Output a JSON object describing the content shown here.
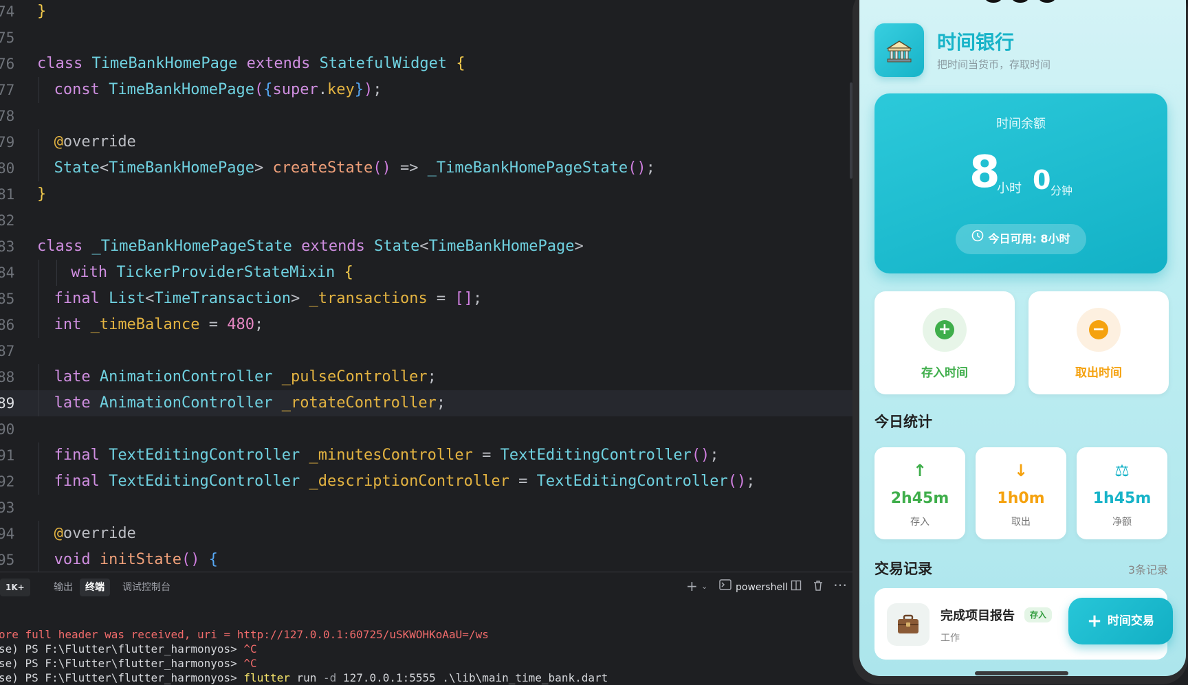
{
  "editor": {
    "lines": [
      {
        "n": "74",
        "tokens": [
          [
            "br1",
            "}"
          ]
        ]
      },
      {
        "n": "75",
        "tokens": []
      },
      {
        "n": "76",
        "tokens": [
          [
            "kw",
            "class "
          ],
          [
            "cls",
            "TimeBankHomePage "
          ],
          [
            "kw",
            "extends "
          ],
          [
            "cls",
            "StatefulWidget "
          ],
          [
            "br1",
            "{"
          ]
        ]
      },
      {
        "n": "77",
        "indent": 1,
        "tokens": [
          [
            "kw",
            "const "
          ],
          [
            "cls",
            "TimeBankHomePage"
          ],
          [
            "br2",
            "("
          ],
          [
            "br3",
            "{"
          ],
          [
            "kw",
            "super"
          ],
          [
            "punc",
            "."
          ],
          [
            "ann",
            "key"
          ],
          [
            "br3",
            "}"
          ],
          [
            "br2",
            ")"
          ],
          [
            "punc",
            ";"
          ]
        ]
      },
      {
        "n": "78",
        "tokens": []
      },
      {
        "n": "79",
        "indent": 1,
        "tokens": [
          [
            "ann",
            "@"
          ],
          [
            "punc",
            "override"
          ]
        ]
      },
      {
        "n": "80",
        "indent": 1,
        "tokens": [
          [
            "cls",
            "State"
          ],
          [
            "punc",
            "<"
          ],
          [
            "cls",
            "TimeBankHomePage"
          ],
          [
            "punc",
            "> "
          ],
          [
            "fn",
            "createState"
          ],
          [
            "br2",
            "()"
          ],
          [
            "punc",
            " => "
          ],
          [
            "cls",
            "_TimeBankHomePageState"
          ],
          [
            "br2",
            "()"
          ],
          [
            "punc",
            ";"
          ]
        ]
      },
      {
        "n": "81",
        "tokens": [
          [
            "br1",
            "}"
          ]
        ]
      },
      {
        "n": "82",
        "tokens": []
      },
      {
        "n": "83",
        "tokens": [
          [
            "kw",
            "class "
          ],
          [
            "cls",
            "_TimeBankHomePageState "
          ],
          [
            "kw",
            "extends "
          ],
          [
            "cls",
            "State"
          ],
          [
            "punc",
            "<"
          ],
          [
            "cls",
            "TimeBankHomePage"
          ],
          [
            "punc",
            ">"
          ]
        ]
      },
      {
        "n": "84",
        "indent": 2,
        "tokens": [
          [
            "kw",
            "with "
          ],
          [
            "cls",
            "TickerProviderStateMixin "
          ],
          [
            "br1",
            "{"
          ]
        ]
      },
      {
        "n": "85",
        "indent": 1,
        "tokens": [
          [
            "kw",
            "final "
          ],
          [
            "cls",
            "List"
          ],
          [
            "punc",
            "<"
          ],
          [
            "cls",
            "TimeTransaction"
          ],
          [
            "punc",
            "> "
          ],
          [
            "ann",
            "_transactions"
          ],
          [
            "punc",
            " = "
          ],
          [
            "br2",
            "[]"
          ],
          [
            "punc",
            ";"
          ]
        ]
      },
      {
        "n": "86",
        "indent": 1,
        "tokens": [
          [
            "kw",
            "int "
          ],
          [
            "ann",
            "_timeBalance"
          ],
          [
            "punc",
            " = "
          ],
          [
            "num",
            "480"
          ],
          [
            "punc",
            ";"
          ]
        ]
      },
      {
        "n": "87",
        "tokens": []
      },
      {
        "n": "88",
        "indent": 1,
        "tokens": [
          [
            "kw",
            "late "
          ],
          [
            "cls",
            "AnimationController "
          ],
          [
            "ann",
            "_pulseController"
          ],
          [
            "punc",
            ";"
          ]
        ]
      },
      {
        "n": "89",
        "indent": 1,
        "current": true,
        "tokens": [
          [
            "kw",
            "late "
          ],
          [
            "cls",
            "AnimationController "
          ],
          [
            "ann",
            "_rotateController"
          ],
          [
            "punc",
            ";"
          ]
        ]
      },
      {
        "n": "90",
        "tokens": []
      },
      {
        "n": "91",
        "indent": 1,
        "tokens": [
          [
            "kw",
            "final "
          ],
          [
            "cls",
            "TextEditingController "
          ],
          [
            "ann",
            "_minutesController"
          ],
          [
            "punc",
            " = "
          ],
          [
            "cls",
            "TextEditingController"
          ],
          [
            "br2",
            "()"
          ],
          [
            "punc",
            ";"
          ]
        ]
      },
      {
        "n": "92",
        "indent": 1,
        "tokens": [
          [
            "kw",
            "final "
          ],
          [
            "cls",
            "TextEditingController "
          ],
          [
            "ann",
            "_descriptionController"
          ],
          [
            "punc",
            " = "
          ],
          [
            "cls",
            "TextEditingController"
          ],
          [
            "br2",
            "()"
          ],
          [
            "punc",
            ";"
          ]
        ]
      },
      {
        "n": "93",
        "tokens": []
      },
      {
        "n": "94",
        "indent": 1,
        "tokens": [
          [
            "ann",
            "@"
          ],
          [
            "punc",
            "override"
          ]
        ]
      },
      {
        "n": "95",
        "indent": 1,
        "tokens": [
          [
            "kw",
            "void "
          ],
          [
            "fn",
            "initState"
          ],
          [
            "br2",
            "() "
          ],
          [
            "br3",
            "{"
          ]
        ]
      }
    ]
  },
  "terminal": {
    "badge": "1K+",
    "tabs": [
      "输出",
      "终端",
      "调试控制台"
    ],
    "active_tab": "终端",
    "add_label": "+",
    "shell_label": "powershell",
    "lines": [
      {
        "text": "ore full header was received, uri = http://127.0.0.1:60725/uSKWOHKoAaU=/ws",
        "style": "term-red"
      },
      {
        "prefix": "se) PS F:\\Flutter\\flutter_harmonyos> ",
        "cmd": "^C",
        "cmdstyle": "term-red"
      },
      {
        "prefix": "se) PS F:\\Flutter\\flutter_harmonyos> ",
        "cmd": "^C",
        "cmdstyle": "term-red"
      },
      {
        "prefix": "se) PS F:\\Flutter\\flutter_harmonyos> ",
        "cmd": "flutter",
        "cmdstyle": "term-yellow",
        "rest": " run ",
        "flag": "-d",
        "rest2": " 127.0.0.1:5555 .\\lib\\main_time_bank.dart"
      }
    ]
  },
  "app": {
    "title": "时间银行",
    "subtitle": "把时间当货币，存取时间",
    "icon": "bank-icon",
    "balance": {
      "label": "时间余额",
      "hours": "8",
      "hours_unit": "小时",
      "minutes": "0",
      "minutes_unit": "分钟",
      "today": "今日可用: 8小时"
    },
    "actions": [
      {
        "label": "存入时间",
        "icon": "plus-icon",
        "color": "#3fae4b"
      },
      {
        "label": "取出时间",
        "icon": "minus-icon",
        "color": "#f5a20f"
      }
    ],
    "stats_title": "今日统计",
    "stats": [
      {
        "value": "2h45m",
        "label": "存入",
        "icon": "arrow-up-icon",
        "glyph": "↑",
        "color": "#3fae4b"
      },
      {
        "value": "1h0m",
        "label": "取出",
        "icon": "arrow-down-icon",
        "glyph": "↓",
        "color": "#f5a20f"
      },
      {
        "value": "1h45m",
        "label": "净额",
        "icon": "balance-scale-icon",
        "glyph": "⚖",
        "color": "#17b3c8"
      }
    ],
    "records_title": "交易记录",
    "records_count": "3条记录",
    "transactions": [
      {
        "title": "完成项目报告",
        "badge": "存入",
        "category": "工作",
        "icon": "briefcase-icon"
      }
    ],
    "fab_label": "时间交易",
    "fab_icon": "plus-icon"
  },
  "colors": {
    "accent": "#17b3c8",
    "deposit": "#3fae4b",
    "withdraw": "#f5a20f"
  }
}
